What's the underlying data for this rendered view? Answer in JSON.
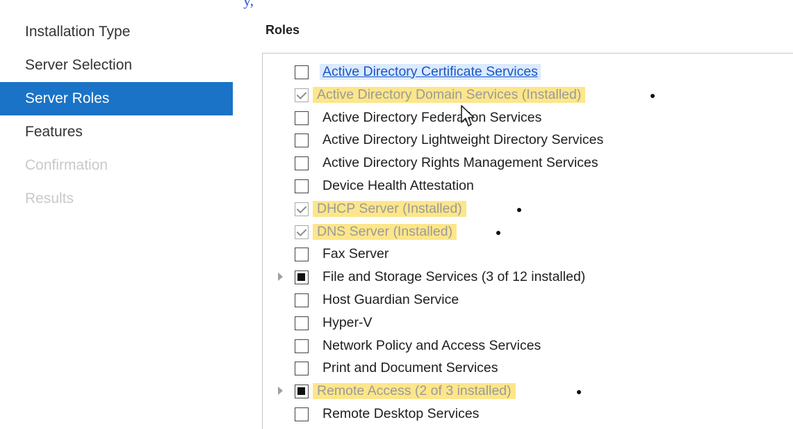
{
  "top_fragment": "y,",
  "nav": {
    "items": [
      {
        "label": "Installation Type",
        "state": "normal"
      },
      {
        "label": "Server Selection",
        "state": "normal"
      },
      {
        "label": "Server Roles",
        "state": "active"
      },
      {
        "label": "Features",
        "state": "normal"
      },
      {
        "label": "Confirmation",
        "state": "disabled"
      },
      {
        "label": "Results",
        "state": "disabled"
      }
    ]
  },
  "roles_title": "Roles",
  "roles": [
    {
      "label": "Active Directory Certificate Services",
      "checkbox": "unchecked",
      "style": "selected"
    },
    {
      "label": "Active Directory Domain Services (Installed)",
      "checkbox": "checked",
      "style": "installed-highlighted",
      "dot": true
    },
    {
      "label": "Active Directory Federation Services",
      "checkbox": "unchecked"
    },
    {
      "label": "Active Directory Lightweight Directory Services",
      "checkbox": "unchecked"
    },
    {
      "label": "Active Directory Rights Management Services",
      "checkbox": "unchecked"
    },
    {
      "label": "Device Health Attestation",
      "checkbox": "unchecked"
    },
    {
      "label": "DHCP Server (Installed)",
      "checkbox": "checked",
      "style": "installed-highlighted",
      "dot": true
    },
    {
      "label": "DNS Server (Installed)",
      "checkbox": "checked",
      "style": "installed-highlighted",
      "dot": true
    },
    {
      "label": "Fax Server",
      "checkbox": "unchecked"
    },
    {
      "label": "File and Storage Services (3 of 12 installed)",
      "checkbox": "partial",
      "expander": true
    },
    {
      "label": "Host Guardian Service",
      "checkbox": "unchecked"
    },
    {
      "label": "Hyper-V",
      "checkbox": "unchecked"
    },
    {
      "label": "Network Policy and Access Services",
      "checkbox": "unchecked"
    },
    {
      "label": "Print and Document Services",
      "checkbox": "unchecked"
    },
    {
      "label": "Remote Access (2 of 3 installed)",
      "checkbox": "partial",
      "expander": true,
      "style": "installed-highlighted",
      "dot": true
    },
    {
      "label": "Remote Desktop Services",
      "checkbox": "unchecked"
    }
  ]
}
